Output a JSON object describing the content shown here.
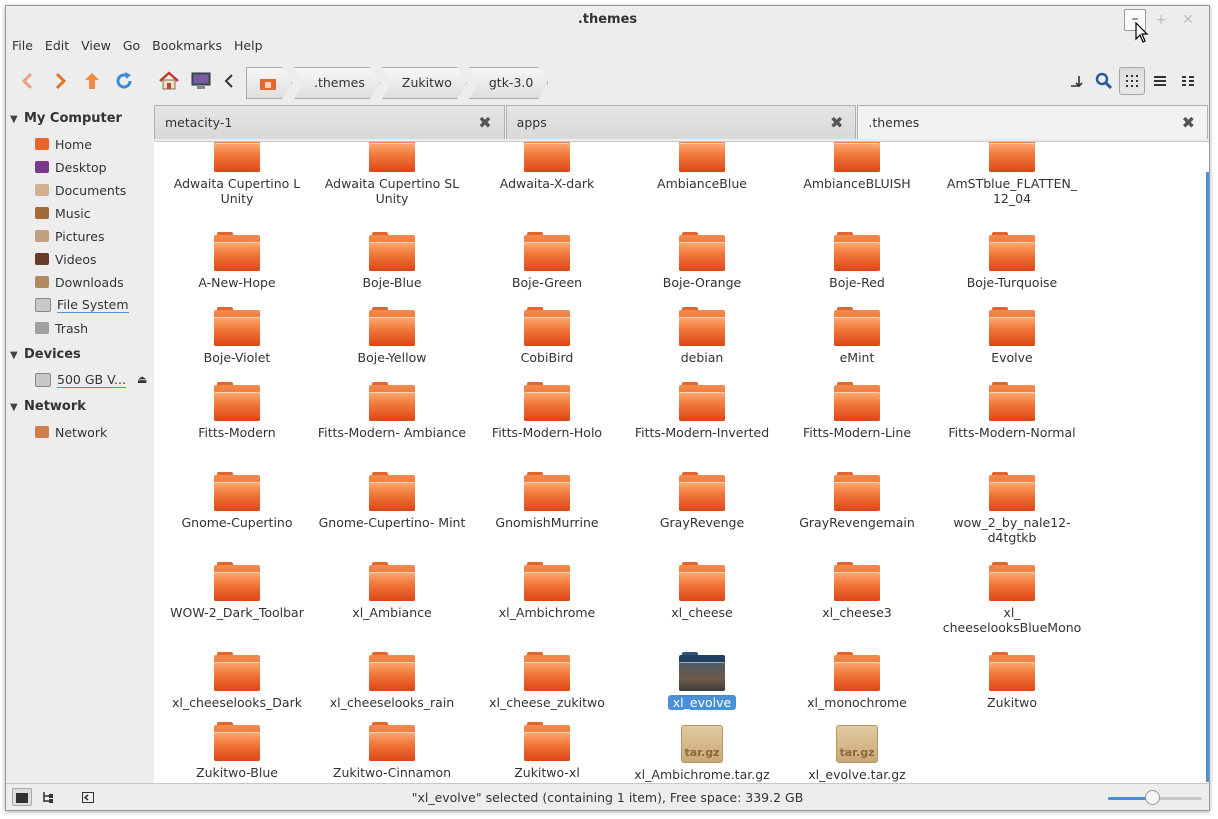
{
  "window": {
    "title": ".themes"
  },
  "menubar": [
    "File",
    "Edit",
    "View",
    "Go",
    "Bookmarks",
    "Help"
  ],
  "breadcrumbs": [
    ".themes",
    "Zukitwo",
    "gtk-3.0"
  ],
  "sidebar": {
    "sections": [
      {
        "title": "My Computer",
        "items": [
          "Home",
          "Desktop",
          "Documents",
          "Music",
          "Pictures",
          "Videos",
          "Downloads",
          "File System",
          "Trash"
        ]
      },
      {
        "title": "Devices",
        "items": [
          "500 GB V..."
        ]
      },
      {
        "title": "Network",
        "items": [
          "Network"
        ]
      }
    ]
  },
  "tabs": [
    {
      "label": "metacity-1",
      "active": false
    },
    {
      "label": "apps",
      "active": false
    },
    {
      "label": ".themes",
      "active": true
    }
  ],
  "items": [
    {
      "name": "Adwaita Cupertino L Unity",
      "type": "folder"
    },
    {
      "name": "Adwaita Cupertino SL Unity",
      "type": "folder"
    },
    {
      "name": "Adwaita-X-dark",
      "type": "folder"
    },
    {
      "name": "AmbianceBlue",
      "type": "folder"
    },
    {
      "name": "AmbianceBLUISH",
      "type": "folder"
    },
    {
      "name": "AmSTblue_FLATTEN_ 12_04",
      "type": "folder"
    },
    {
      "name": "A-New-Hope",
      "type": "folder"
    },
    {
      "name": "Boje-Blue",
      "type": "folder"
    },
    {
      "name": "Boje-Green",
      "type": "folder"
    },
    {
      "name": "Boje-Orange",
      "type": "folder"
    },
    {
      "name": "Boje-Red",
      "type": "folder"
    },
    {
      "name": "Boje-Turquoise",
      "type": "folder"
    },
    {
      "name": "Boje-Violet",
      "type": "folder"
    },
    {
      "name": "Boje-Yellow",
      "type": "folder"
    },
    {
      "name": "CobiBird",
      "type": "folder"
    },
    {
      "name": "debian",
      "type": "folder"
    },
    {
      "name": "eMint",
      "type": "folder"
    },
    {
      "name": "Evolve",
      "type": "folder"
    },
    {
      "name": "Fitts-Modern",
      "type": "folder"
    },
    {
      "name": "Fitts-Modern- Ambiance",
      "type": "folder"
    },
    {
      "name": "Fitts-Modern-Holo",
      "type": "folder"
    },
    {
      "name": "Fitts-Modern-Inverted",
      "type": "folder"
    },
    {
      "name": "Fitts-Modern-Line",
      "type": "folder"
    },
    {
      "name": "Fitts-Modern-Normal",
      "type": "folder"
    },
    {
      "name": "Gnome-Cupertino",
      "type": "folder"
    },
    {
      "name": "Gnome-Cupertino- Mint",
      "type": "folder"
    },
    {
      "name": "GnomishMurrine",
      "type": "folder"
    },
    {
      "name": "GrayRevenge",
      "type": "folder"
    },
    {
      "name": "GrayRevengemain",
      "type": "folder"
    },
    {
      "name": "wow_2_by_nale12- d4tgtkb",
      "type": "folder"
    },
    {
      "name": "WOW-2_Dark_Toolbar",
      "type": "folder"
    },
    {
      "name": "xl_Ambiance",
      "type": "folder"
    },
    {
      "name": "xl_Ambichrome",
      "type": "folder"
    },
    {
      "name": "xl_cheese",
      "type": "folder"
    },
    {
      "name": "xl_cheese3",
      "type": "folder"
    },
    {
      "name": "xl_ cheeselooksBlueMono",
      "type": "folder"
    },
    {
      "name": "xl_cheeselooks_Dark",
      "type": "folder"
    },
    {
      "name": "xl_cheeselooks_rain",
      "type": "folder"
    },
    {
      "name": "xl_cheese_zukitwo",
      "type": "folder"
    },
    {
      "name": "xl_evolve",
      "type": "folder",
      "selected": true
    },
    {
      "name": "xl_monochrome",
      "type": "folder"
    },
    {
      "name": "Zukitwo",
      "type": "folder"
    },
    {
      "name": "Zukitwo-Blue",
      "type": "folder"
    },
    {
      "name": "Zukitwo-Cinnamon",
      "type": "folder"
    },
    {
      "name": "Zukitwo-xl",
      "type": "folder"
    },
    {
      "name": "xl_Ambichrome.tar.gz",
      "type": "archive",
      "badge": "tar.gz"
    },
    {
      "name": "xl_evolve.tar.gz",
      "type": "archive",
      "badge": "tar.gz"
    }
  ],
  "statusbar": {
    "text": "\"xl_evolve\" selected (containing 1 item), Free space: 339.2 GB",
    "zoom_level": 0.47
  },
  "colors": {
    "accent": "#4a90d9",
    "folder": "#f27a3c"
  },
  "icons": [
    "back-icon",
    "forward-icon",
    "up-icon",
    "reload-icon",
    "home-icon",
    "computer-icon",
    "search-icon",
    "icon-view-icon",
    "list-view-icon",
    "compact-view-icon"
  ]
}
